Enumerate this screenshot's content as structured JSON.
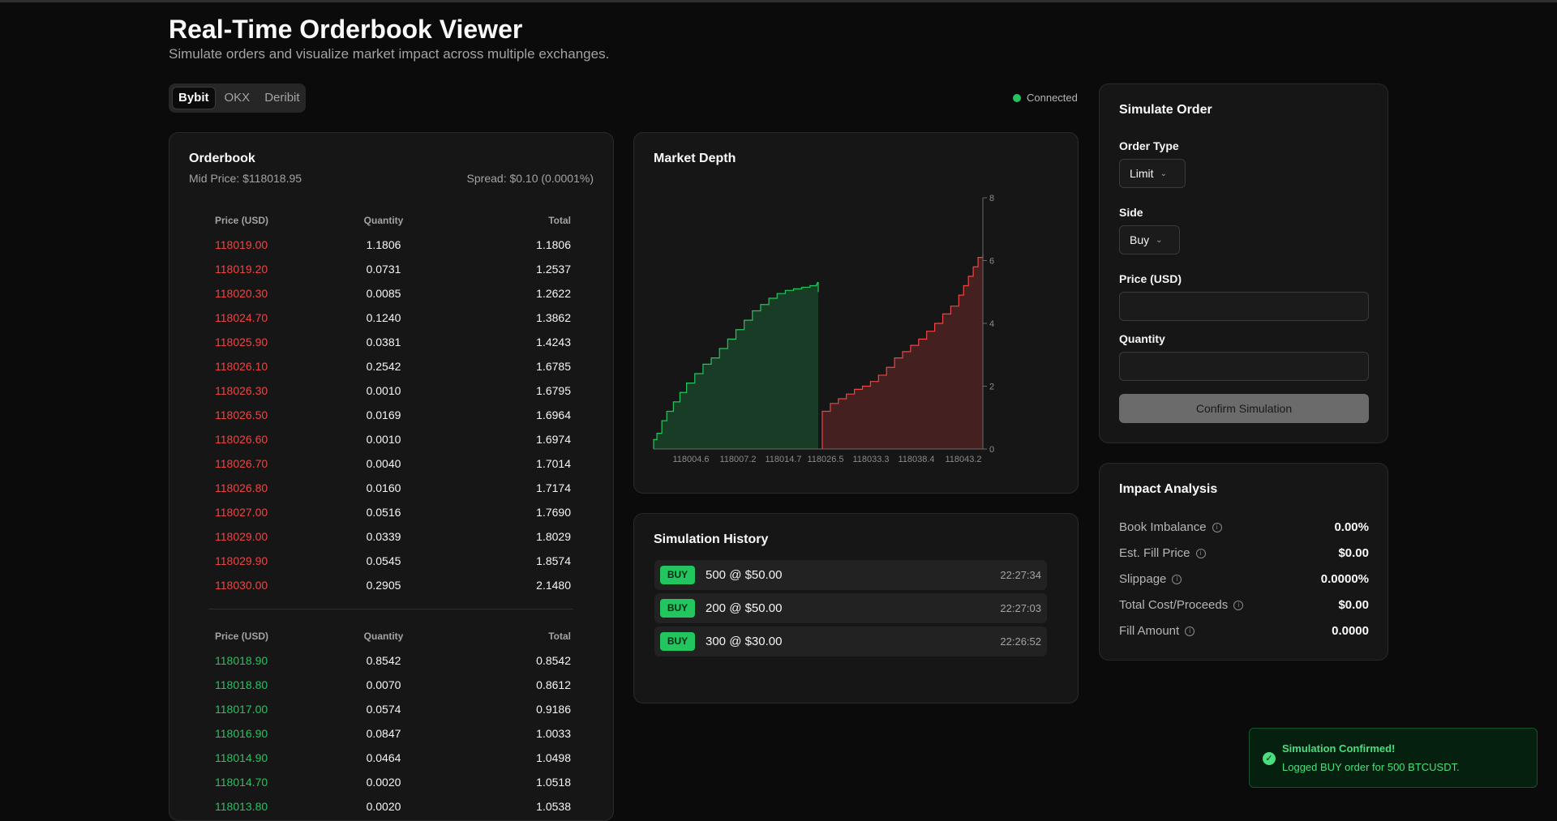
{
  "header": {
    "title": "Real-Time Orderbook Viewer",
    "subtitle": "Simulate orders and visualize market impact across multiple exchanges."
  },
  "exchanges": [
    {
      "label": "Bybit",
      "active": true
    },
    {
      "label": "OKX",
      "active": false
    },
    {
      "label": "Deribit",
      "active": false
    }
  ],
  "status": {
    "label": "Connected",
    "color": "#22c55e"
  },
  "orderbook": {
    "title": "Orderbook",
    "mid_price": "Mid Price: $118018.95",
    "spread": "Spread: $0.10 (0.0001%)",
    "columns": [
      "Price (USD)",
      "Quantity",
      "Total"
    ],
    "asks": [
      [
        "118019.00",
        "1.1806",
        "1.1806"
      ],
      [
        "118019.20",
        "0.0731",
        "1.2537"
      ],
      [
        "118020.30",
        "0.0085",
        "1.2622"
      ],
      [
        "118024.70",
        "0.1240",
        "1.3862"
      ],
      [
        "118025.90",
        "0.0381",
        "1.4243"
      ],
      [
        "118026.10",
        "0.2542",
        "1.6785"
      ],
      [
        "118026.30",
        "0.0010",
        "1.6795"
      ],
      [
        "118026.50",
        "0.0169",
        "1.6964"
      ],
      [
        "118026.60",
        "0.0010",
        "1.6974"
      ],
      [
        "118026.70",
        "0.0040",
        "1.7014"
      ],
      [
        "118026.80",
        "0.0160",
        "1.7174"
      ],
      [
        "118027.00",
        "0.0516",
        "1.7690"
      ],
      [
        "118029.00",
        "0.0339",
        "1.8029"
      ],
      [
        "118029.90",
        "0.0545",
        "1.8574"
      ],
      [
        "118030.00",
        "0.2905",
        "2.1480"
      ]
    ],
    "bids": [
      [
        "118018.90",
        "0.8542",
        "0.8542"
      ],
      [
        "118018.80",
        "0.0070",
        "0.8612"
      ],
      [
        "118017.00",
        "0.0574",
        "0.9186"
      ],
      [
        "118016.90",
        "0.0847",
        "1.0033"
      ],
      [
        "118014.90",
        "0.0464",
        "1.0498"
      ],
      [
        "118014.70",
        "0.0020",
        "1.0518"
      ],
      [
        "118013.80",
        "0.0020",
        "1.0538"
      ]
    ],
    "ask_color": "#ef4444",
    "bid_color": "#22c55e"
  },
  "depth": {
    "title": "Market Depth",
    "chart_data": {
      "type": "area",
      "x_ticks": [
        "118004.6",
        "118007.2",
        "118014.7",
        "118026.5",
        "118033.3",
        "118038.4",
        "118043.2"
      ],
      "y_ticks": [
        0,
        2,
        4,
        6,
        8
      ],
      "ylim": [
        0,
        8
      ],
      "y_axis_side": "right",
      "series": [
        {
          "side": "bids",
          "color": "#22c55e",
          "x": [
            0,
            0.02,
            0.05,
            0.08,
            0.12,
            0.16,
            0.2,
            0.25,
            0.3,
            0.35,
            0.4,
            0.45,
            0.5,
            0.55,
            0.6,
            0.65,
            0.7,
            0.75,
            0.8,
            0.85,
            0.9,
            0.95,
            0.99,
            0.995,
            1.0
          ],
          "y": [
            0.3,
            0.5,
            0.9,
            1.2,
            1.5,
            1.8,
            2.1,
            2.4,
            2.7,
            2.9,
            3.2,
            3.5,
            3.8,
            4.1,
            4.4,
            4.6,
            4.8,
            4.95,
            5.05,
            5.1,
            5.15,
            5.2,
            5.25,
            5.3,
            5.0
          ]
        },
        {
          "side": "asks",
          "color": "#ef4444",
          "x": [
            0,
            0.05,
            0.1,
            0.15,
            0.2,
            0.25,
            0.3,
            0.35,
            0.4,
            0.45,
            0.5,
            0.55,
            0.6,
            0.65,
            0.7,
            0.75,
            0.8,
            0.85,
            0.88,
            0.91,
            0.94,
            0.97,
            1.0
          ],
          "y": [
            1.2,
            1.45,
            1.6,
            1.75,
            1.9,
            2.0,
            2.15,
            2.35,
            2.6,
            2.9,
            3.1,
            3.3,
            3.5,
            3.75,
            4.0,
            4.3,
            4.55,
            4.9,
            5.2,
            5.5,
            5.8,
            6.1,
            6.2
          ]
        }
      ]
    }
  },
  "history": {
    "title": "Simulation History",
    "items": [
      {
        "side": "BUY",
        "text": "500 @ $50.00",
        "time": "22:27:34"
      },
      {
        "side": "BUY",
        "text": "200 @ $50.00",
        "time": "22:27:03"
      },
      {
        "side": "BUY",
        "text": "300 @ $30.00",
        "time": "22:26:52"
      }
    ]
  },
  "simulate": {
    "title": "Simulate Order",
    "order_type_label": "Order Type",
    "order_type_value": "Limit",
    "side_label": "Side",
    "side_value": "Buy",
    "price_label": "Price (USD)",
    "price_value": "",
    "quantity_label": "Quantity",
    "quantity_value": "",
    "confirm_label": "Confirm Simulation"
  },
  "impact": {
    "title": "Impact Analysis",
    "rows": [
      {
        "label": "Book Imbalance",
        "value": "0.00%"
      },
      {
        "label": "Est. Fill Price",
        "value": "$0.00"
      },
      {
        "label": "Slippage",
        "value": "0.0000%"
      },
      {
        "label": "Total Cost/Proceeds",
        "value": "$0.00"
      },
      {
        "label": "Fill Amount",
        "value": "0.0000"
      }
    ]
  },
  "toast": {
    "title": "Simulation Confirmed!",
    "message": "Logged BUY order for 500 BTCUSDT."
  }
}
